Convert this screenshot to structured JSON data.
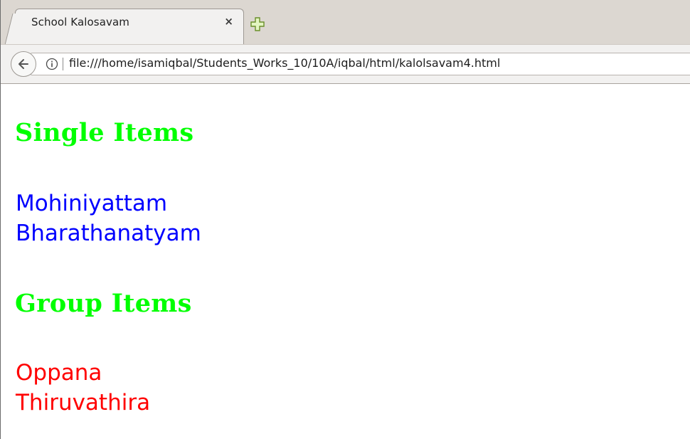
{
  "browser": {
    "tab": {
      "title": "School Kalosavam",
      "close_glyph": "×"
    },
    "address_bar": {
      "url": "file:///home/isamiqbal/Students_Works_10/10A/iqbal/html/kalolsavam4.html"
    },
    "icons": {
      "back": "back-arrow-icon",
      "info": "info-icon",
      "new_tab": "plus-icon",
      "close": "close-icon"
    }
  },
  "page": {
    "sections": [
      {
        "heading": "Single Items",
        "items": [
          "Mohiniyattam",
          "Bharathanatyam"
        ],
        "item_color": "#0000ff"
      },
      {
        "heading": "Group Items",
        "items": [
          "Oppana",
          "Thiruvathira"
        ],
        "item_color": "#ff0000"
      }
    ],
    "heading_color": "#00ff00"
  }
}
